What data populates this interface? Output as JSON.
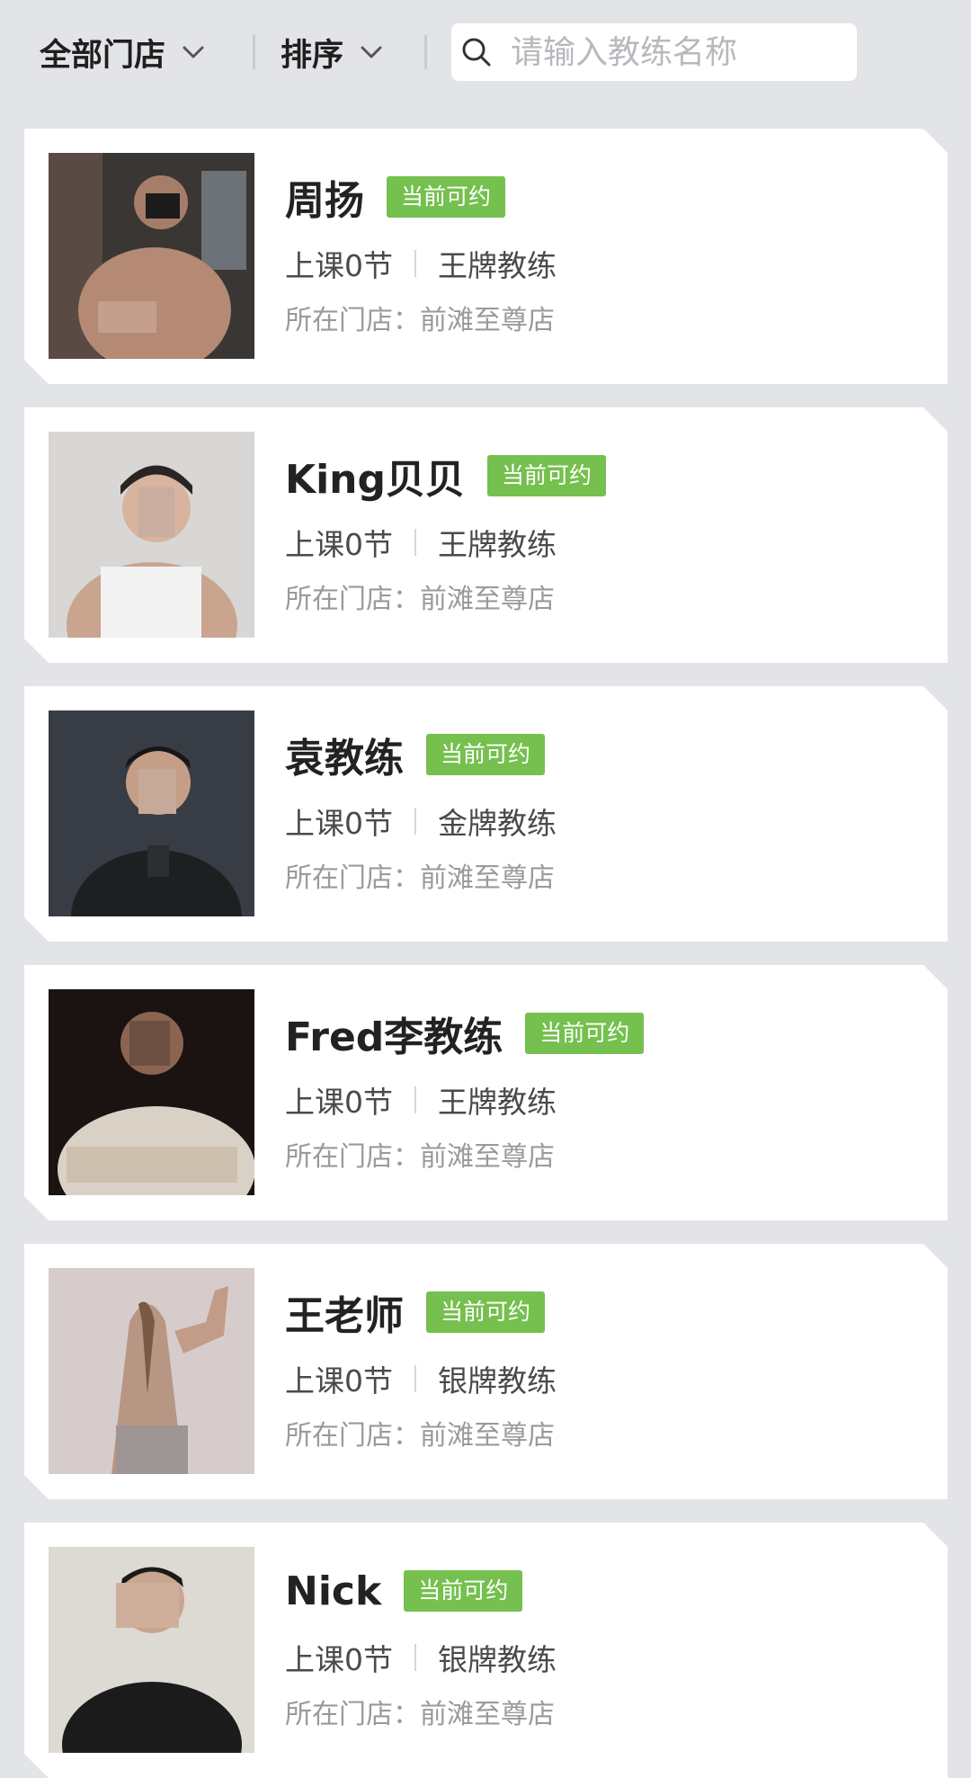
{
  "filters": {
    "store_label": "全部门店",
    "sort_label": "排序",
    "search_placeholder": "请输入教练名称",
    "search_value": ""
  },
  "colors": {
    "background": "#e2e4e7",
    "card": "#ffffff",
    "badge": "#75c04e"
  },
  "icons": {
    "store_chevron": "chevron-down-icon",
    "sort_chevron": "chevron-down-icon",
    "search": "search-icon"
  },
  "coaches": [
    {
      "name": "周扬",
      "badge": "当前可约",
      "lessons": "上课0节",
      "level": "王牌教练",
      "store": "所在门店：前滩至尊店"
    },
    {
      "name": "King贝贝",
      "badge": "当前可约",
      "lessons": "上课0节",
      "level": "王牌教练",
      "store": "所在门店：前滩至尊店"
    },
    {
      "name": "袁教练",
      "badge": "当前可约",
      "lessons": "上课0节",
      "level": "金牌教练",
      "store": "所在门店：前滩至尊店"
    },
    {
      "name": "Fred李教练",
      "badge": "当前可约",
      "lessons": "上课0节",
      "level": "王牌教练",
      "store": "所在门店：前滩至尊店"
    },
    {
      "name": "王老师",
      "badge": "当前可约",
      "lessons": "上课0节",
      "level": "银牌教练",
      "store": "所在门店：前滩至尊店"
    },
    {
      "name": "Nick",
      "badge": "当前可约",
      "lessons": "上课0节",
      "level": "银牌教练",
      "store": "所在门店：前滩至尊店"
    }
  ]
}
